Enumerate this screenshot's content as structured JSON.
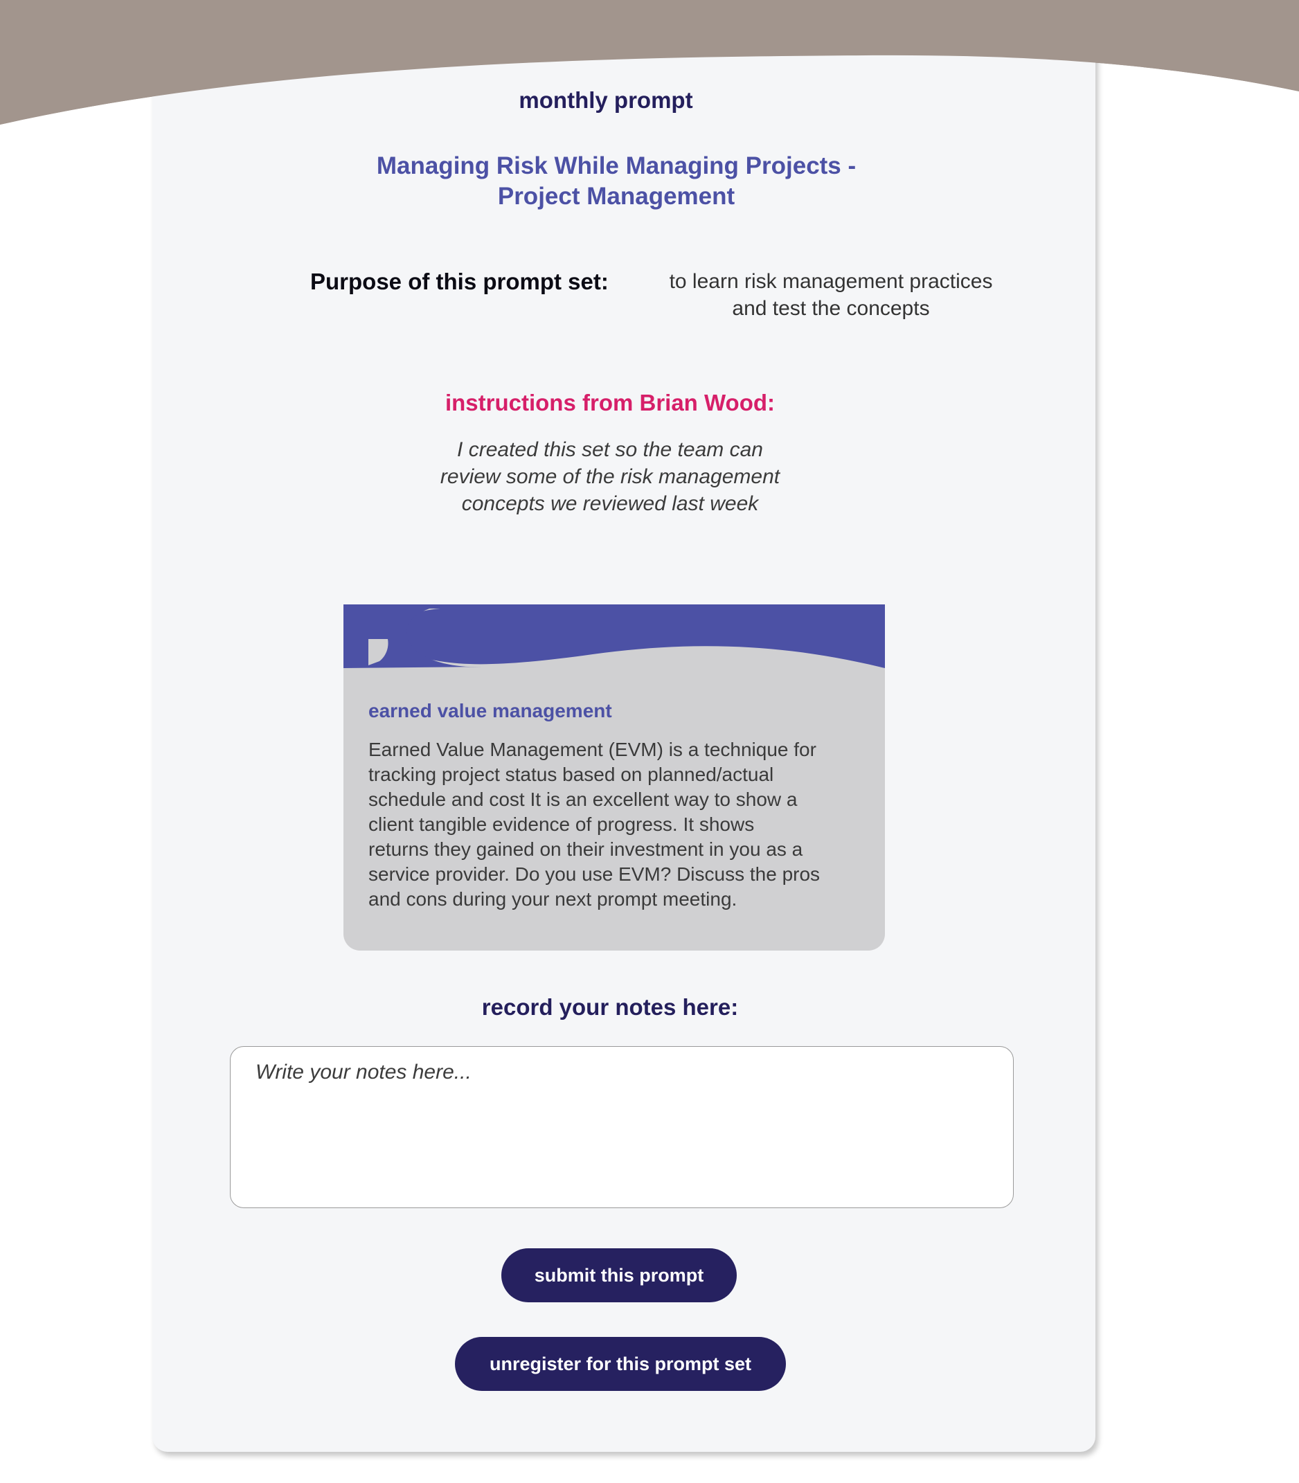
{
  "colors": {
    "header_wave": "#a2958d",
    "page_card": "#f5f6f8",
    "accent_navy": "#262160",
    "accent_indigo": "#4c51a5",
    "accent_pink": "#d61f69",
    "prompt_card_bg": "#d0d0d2"
  },
  "header": {
    "eyebrow": "monthly prompt",
    "title_line1": "Managing Risk While Managing Projects -",
    "title_line2": "Project Management"
  },
  "purpose": {
    "label": "Purpose of this prompt set:",
    "text_line1": "to learn risk management practices",
    "text_line2": "and test the concepts"
  },
  "instructions": {
    "heading": "instructions from Brian Wood:",
    "line1": "I created this set so the team can",
    "line2": "review some of the risk management",
    "line3": "concepts we reviewed last week"
  },
  "prompt_card": {
    "title": "earned value management",
    "body_lines": [
      "Earned Value Management (EVM) is a technique for",
      "tracking project status based on planned/actual",
      "schedule and cost It is an excellent way to show a",
      "client tangible evidence of progress. It shows",
      "returns they gained on their investment in you as a",
      "service provider. Do you use EVM? Discuss the pros",
      "and cons during your next prompt meeting."
    ]
  },
  "notes": {
    "heading": "record your notes here:",
    "placeholder": "Write your notes here...",
    "value": ""
  },
  "buttons": {
    "submit": "submit this prompt",
    "unregister": "unregister for this prompt set"
  }
}
